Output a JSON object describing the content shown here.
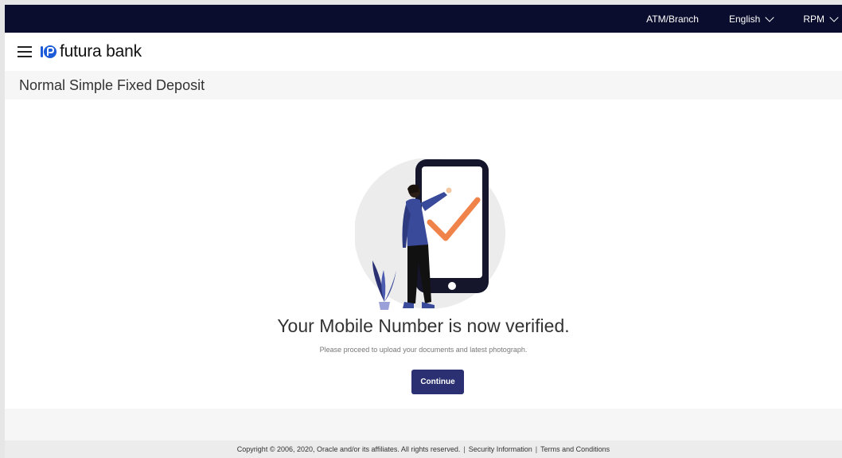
{
  "topbar": {
    "atm_branch": "ATM/Branch",
    "language": "English",
    "user": "RPM"
  },
  "header": {
    "logo_text": "futura bank"
  },
  "page": {
    "title": "Normal Simple Fixed Deposit"
  },
  "content": {
    "verified_message": "Your Mobile Number is now verified.",
    "sub_message": "Please proceed to upload your documents and latest photograph.",
    "continue_label": "Continue"
  },
  "footer": {
    "copyright": "Copyright © 2006, 2020, Oracle and/or its affiliates. All rights reserved.",
    "separator": "|",
    "security_info": "Security Information",
    "terms": "Terms and Conditions"
  },
  "colors": {
    "topbar_bg": "#0a0d2e",
    "primary_button": "#2a3071",
    "check_orange": "#f0834a",
    "figure_blue": "#3a4a9a"
  },
  "icons": {
    "menu": "hamburger-icon",
    "language_dropdown": "chevron-down-icon",
    "user_dropdown": "chevron-down-icon",
    "logo": "futura-bank-logo-icon"
  }
}
